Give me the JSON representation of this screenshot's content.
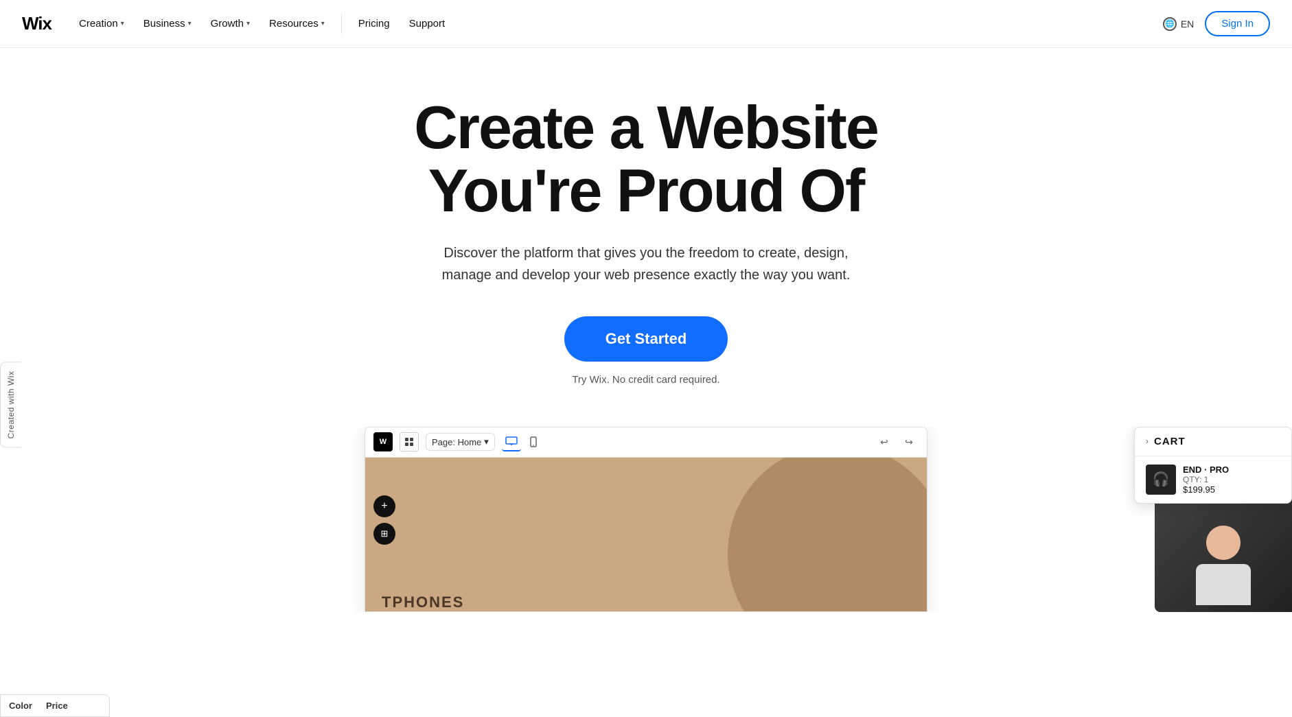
{
  "navbar": {
    "logo": "Wix",
    "nav_items": [
      {
        "label": "Creation",
        "has_dropdown": true
      },
      {
        "label": "Business",
        "has_dropdown": true
      },
      {
        "label": "Growth",
        "has_dropdown": true
      },
      {
        "label": "Resources",
        "has_dropdown": true
      },
      {
        "label": "Pricing",
        "has_dropdown": false
      },
      {
        "label": "Support",
        "has_dropdown": false
      }
    ],
    "lang": "EN",
    "sign_in": "Sign In"
  },
  "hero": {
    "title": "Create a Website You're Proud Of",
    "subtitle": "Discover the platform that gives you the freedom to create, design, manage and develop your web presence exactly the way you want.",
    "cta_label": "Get Started",
    "note": "Try Wix. No credit card required."
  },
  "side_tab": {
    "label": "Created with Wix"
  },
  "editor": {
    "logo": "W",
    "page_label": "Page: Home",
    "toolbar_icons": [
      "desktop",
      "mobile"
    ],
    "canvas_text": "TPHONES",
    "undo": "↩",
    "redo": "↪"
  },
  "cart": {
    "chevron": "›",
    "title": "CART",
    "item": {
      "name": "END · PRO",
      "qty": "QTY: 1",
      "price": "$199.95"
    }
  },
  "bottom_bar": {
    "color_label": "Color",
    "price_label": "Price"
  }
}
